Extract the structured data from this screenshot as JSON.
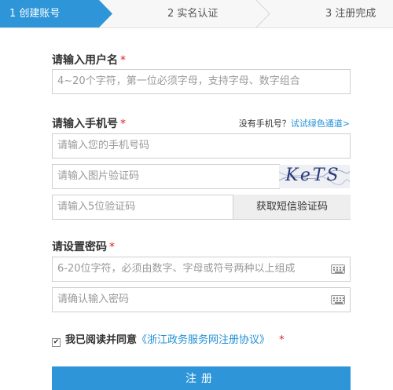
{
  "steps": [
    {
      "label": "1 创建账号",
      "active": true
    },
    {
      "label": "2 实名认证",
      "active": false
    },
    {
      "label": "3 注册完成",
      "active": false
    }
  ],
  "username": {
    "label": "请输入用户名",
    "required_mark": "*",
    "placeholder": "4~20个字符，第一位必须字母，支持字母、数字组合"
  },
  "phone": {
    "label": "请输入手机号",
    "required_mark": "*",
    "no_phone_text": "没有手机号？",
    "green_channel_link": "试试绿色通道>",
    "placeholder": "请输入您的手机号码",
    "image_code_placeholder": "请输入图片验证码",
    "captcha_text": "KeTS",
    "sms_code_placeholder": "请输入5位验证码",
    "sms_button": "获取短信验证码"
  },
  "password": {
    "label": "请设置密码",
    "required_mark": "*",
    "placeholder": "6-20位字符，必须由数字、字母或符号两种以上组成",
    "confirm_placeholder": "请确认输入密码",
    "keyboard_icon": "keyboard-icon"
  },
  "agreement": {
    "checked": true,
    "text": "我已阅读并同意",
    "protocol": "《浙江政务服务网注册协议》",
    "required_mark": "*"
  },
  "submit_label": "注册",
  "colors": {
    "accent": "#2d95d8",
    "link": "#1f8fd6",
    "required": "#e02020",
    "step_inactive_bg": "#f7f7f7"
  }
}
